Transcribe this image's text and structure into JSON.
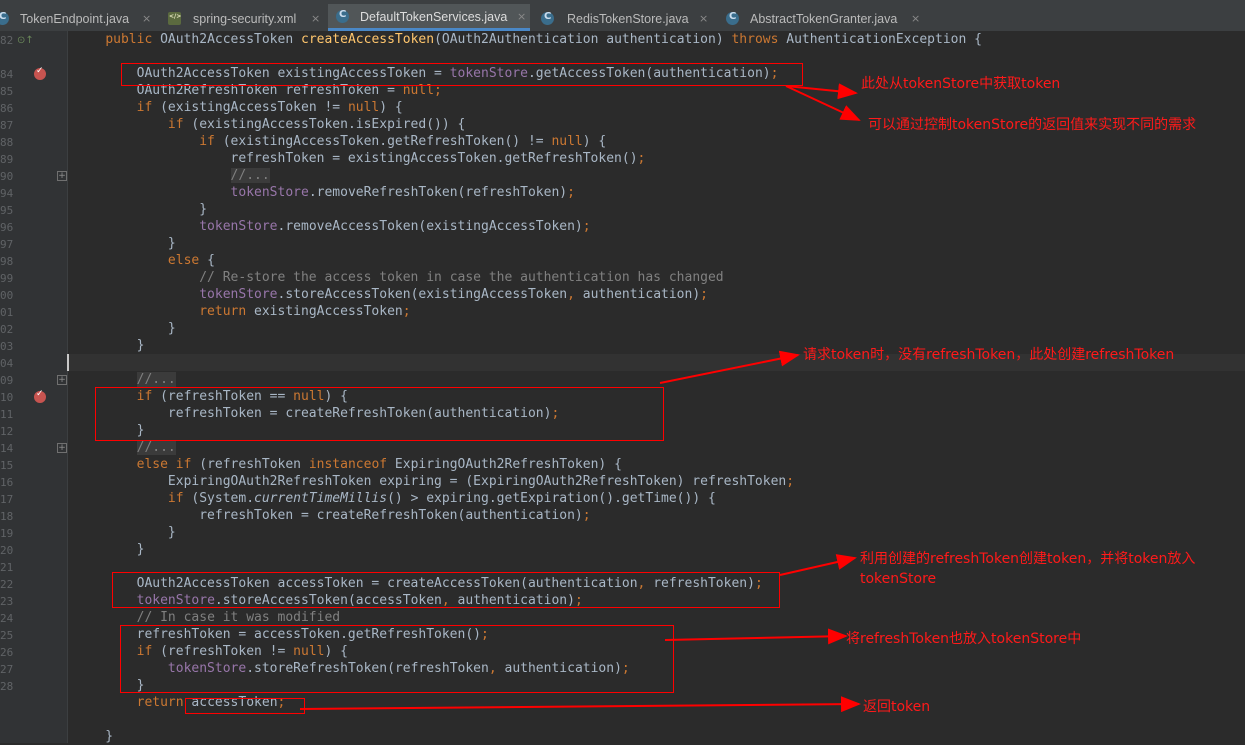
{
  "tabs": [
    {
      "label": "TokenEndpoint.java",
      "icon": "java-file-icon",
      "active": false
    },
    {
      "label": "spring-security.xml",
      "icon": "xml-file-icon",
      "active": false
    },
    {
      "label": "DefaultTokenServices.java",
      "icon": "class-file-icon",
      "active": true
    },
    {
      "label": "RedisTokenStore.java",
      "icon": "class-file-icon",
      "active": false
    },
    {
      "label": "AbstractTokenGranter.java",
      "icon": "class-file-icon",
      "active": false
    }
  ],
  "close_glyph": "×",
  "fold_glyph": "+",
  "line_numbers": [
    "82",
    "84",
    "85",
    "86",
    "87",
    "88",
    "89",
    "90",
    "94",
    "95",
    "96",
    "97",
    "98",
    "99",
    "00",
    "01",
    "02",
    "03",
    "04",
    "09",
    "10",
    "11",
    "12",
    "14",
    "15",
    "16",
    "17",
    "18",
    "19",
    "20",
    "21",
    "22",
    "23",
    "24",
    "25",
    "26",
    "27",
    "28"
  ],
  "code": [
    [
      {
        "t": "    ",
        "c": "p"
      },
      {
        "t": "public ",
        "c": "k"
      },
      {
        "t": "OAuth2AccessToken ",
        "c": "p"
      },
      {
        "t": "createAccessToken",
        "c": "f"
      },
      {
        "t": "(OAuth2Authentication authentication) ",
        "c": "p"
      },
      {
        "t": "throws ",
        "c": "k"
      },
      {
        "t": "AuthenticationException {",
        "c": "p"
      }
    ],
    [],
    [
      {
        "t": "        OAuth2AccessToken existingAccessToken = ",
        "c": "p"
      },
      {
        "t": "tokenStore",
        "c": "v"
      },
      {
        "t": ".getAccessToken(authentication)",
        "c": "p"
      },
      {
        "t": ";",
        "c": "k"
      }
    ],
    [
      {
        "t": "        OAuth2RefreshToken refreshToken = ",
        "c": "p"
      },
      {
        "t": "null",
        "c": "k"
      },
      {
        "t": ";",
        "c": "k"
      }
    ],
    [
      {
        "t": "        ",
        "c": "p"
      },
      {
        "t": "if ",
        "c": "k"
      },
      {
        "t": "(existingAccessToken != ",
        "c": "p"
      },
      {
        "t": "null",
        "c": "k"
      },
      {
        "t": ") {",
        "c": "p"
      }
    ],
    [
      {
        "t": "            ",
        "c": "p"
      },
      {
        "t": "if ",
        "c": "k"
      },
      {
        "t": "(existingAccessToken.isExpired()) {",
        "c": "p"
      }
    ],
    [
      {
        "t": "                ",
        "c": "p"
      },
      {
        "t": "if ",
        "c": "k"
      },
      {
        "t": "(existingAccessToken.getRefreshToken() != ",
        "c": "p"
      },
      {
        "t": "null",
        "c": "k"
      },
      {
        "t": ") {",
        "c": "p"
      }
    ],
    [
      {
        "t": "                    refreshToken = existingAccessToken.getRefreshToken()",
        "c": "p"
      },
      {
        "t": ";",
        "c": "k"
      }
    ],
    [
      {
        "t": "                    ",
        "c": "p"
      },
      {
        "t": "//...",
        "c": "cmh"
      }
    ],
    [
      {
        "t": "                    ",
        "c": "p"
      },
      {
        "t": "tokenStore",
        "c": "v"
      },
      {
        "t": ".removeRefreshToken(refreshToken)",
        "c": "p"
      },
      {
        "t": ";",
        "c": "k"
      }
    ],
    [
      {
        "t": "                }",
        "c": "p"
      }
    ],
    [
      {
        "t": "                ",
        "c": "p"
      },
      {
        "t": "tokenStore",
        "c": "v"
      },
      {
        "t": ".removeAccessToken(existingAccessToken)",
        "c": "p"
      },
      {
        "t": ";",
        "c": "k"
      }
    ],
    [
      {
        "t": "            }",
        "c": "p"
      }
    ],
    [
      {
        "t": "            ",
        "c": "p"
      },
      {
        "t": "else ",
        "c": "k"
      },
      {
        "t": "{",
        "c": "p"
      }
    ],
    [
      {
        "t": "                ",
        "c": "p"
      },
      {
        "t": "// Re-store the access token in case the authentication has changed",
        "c": "cm"
      }
    ],
    [
      {
        "t": "                ",
        "c": "p"
      },
      {
        "t": "tokenStore",
        "c": "v"
      },
      {
        "t": ".storeAccessToken(existingAccessToken",
        "c": "p"
      },
      {
        "t": ", ",
        "c": "k"
      },
      {
        "t": "authentication)",
        "c": "p"
      },
      {
        "t": ";",
        "c": "k"
      }
    ],
    [
      {
        "t": "                ",
        "c": "p"
      },
      {
        "t": "return ",
        "c": "k"
      },
      {
        "t": "existingAccessToken",
        "c": "p"
      },
      {
        "t": ";",
        "c": "k"
      }
    ],
    [
      {
        "t": "            }",
        "c": "p"
      }
    ],
    [
      {
        "t": "        }",
        "c": "p"
      }
    ],
    [],
    [
      {
        "t": "        ",
        "c": "p"
      },
      {
        "t": "//...",
        "c": "cmh"
      }
    ],
    [
      {
        "t": "        ",
        "c": "p"
      },
      {
        "t": "if ",
        "c": "k"
      },
      {
        "t": "(refreshToken == ",
        "c": "p"
      },
      {
        "t": "null",
        "c": "k"
      },
      {
        "t": ") {",
        "c": "p"
      }
    ],
    [
      {
        "t": "            refreshToken = createRefreshToken(authentication)",
        "c": "p"
      },
      {
        "t": ";",
        "c": "k"
      }
    ],
    [
      {
        "t": "        }",
        "c": "p"
      }
    ],
    [
      {
        "t": "        ",
        "c": "p"
      },
      {
        "t": "//...",
        "c": "cmh"
      }
    ],
    [
      {
        "t": "        ",
        "c": "p"
      },
      {
        "t": "else if ",
        "c": "k"
      },
      {
        "t": "(refreshToken ",
        "c": "p"
      },
      {
        "t": "instanceof ",
        "c": "k"
      },
      {
        "t": "ExpiringOAuth2RefreshToken) {",
        "c": "p"
      }
    ],
    [
      {
        "t": "            ExpiringOAuth2RefreshToken expiring = (ExpiringOAuth2RefreshToken) refreshToken",
        "c": "p"
      },
      {
        "t": ";",
        "c": "k"
      }
    ],
    [
      {
        "t": "            ",
        "c": "p"
      },
      {
        "t": "if ",
        "c": "k"
      },
      {
        "t": "(System.",
        "c": "p"
      },
      {
        "t": "currentTimeMillis",
        "c": "i"
      },
      {
        "t": "() > expiring.getExpiration().getTime()) {",
        "c": "p"
      }
    ],
    [
      {
        "t": "                refreshToken = createRefreshToken(authentication)",
        "c": "p"
      },
      {
        "t": ";",
        "c": "k"
      }
    ],
    [
      {
        "t": "            }",
        "c": "p"
      }
    ],
    [
      {
        "t": "        }",
        "c": "p"
      }
    ],
    [],
    [
      {
        "t": "        OAuth2AccessToken accessToken = createAccessToken(authentication",
        "c": "p"
      },
      {
        "t": ", ",
        "c": "k"
      },
      {
        "t": "refreshToken)",
        "c": "p"
      },
      {
        "t": ";",
        "c": "k"
      }
    ],
    [
      {
        "t": "        ",
        "c": "p"
      },
      {
        "t": "tokenStore",
        "c": "v"
      },
      {
        "t": ".storeAccessToken(accessToken",
        "c": "p"
      },
      {
        "t": ", ",
        "c": "k"
      },
      {
        "t": "authentication)",
        "c": "p"
      },
      {
        "t": ";",
        "c": "k"
      }
    ],
    [
      {
        "t": "        ",
        "c": "p"
      },
      {
        "t": "// In case it was modified",
        "c": "cm"
      }
    ],
    [
      {
        "t": "        refreshToken = accessToken.getRefreshToken()",
        "c": "p"
      },
      {
        "t": ";",
        "c": "k"
      }
    ],
    [
      {
        "t": "        ",
        "c": "p"
      },
      {
        "t": "if ",
        "c": "k"
      },
      {
        "t": "(refreshToken != ",
        "c": "p"
      },
      {
        "t": "null",
        "c": "k"
      },
      {
        "t": ") {",
        "c": "p"
      }
    ],
    [
      {
        "t": "            ",
        "c": "p"
      },
      {
        "t": "tokenStore",
        "c": "v"
      },
      {
        "t": ".storeRefreshToken(refreshToken",
        "c": "p"
      },
      {
        "t": ", ",
        "c": "k"
      },
      {
        "t": "authentication)",
        "c": "p"
      },
      {
        "t": ";",
        "c": "k"
      }
    ],
    [
      {
        "t": "        }",
        "c": "p"
      }
    ],
    [
      {
        "t": "        ",
        "c": "p"
      },
      {
        "t": "return ",
        "c": "k"
      },
      {
        "t": "accessToken",
        "c": "p"
      },
      {
        "t": ";",
        "c": "k"
      }
    ],
    [],
    [
      {
        "t": "    }",
        "c": "p"
      }
    ]
  ],
  "annotations": {
    "note1": "此处从tokenStore中获取token",
    "note2": "可以通过控制tokenStore的返回值来实现不同的需求",
    "note3": "请求token时，没有refreshToken，此处创建refreshToken",
    "note4_line1": "利用创建的refreshToken创建token，并将token放入",
    "note4_line2": "tokenStore",
    "note5": "将refreshToken也放入tokenStore中",
    "note6": "返回token"
  },
  "colors": {
    "keyword": "#cc7832",
    "plain": "#a9b7c6",
    "field": "#9876aa",
    "method": "#ffc66d",
    "comment": "#808080",
    "annotation_red": "#ff0000",
    "breakpoint": "#c75450"
  }
}
